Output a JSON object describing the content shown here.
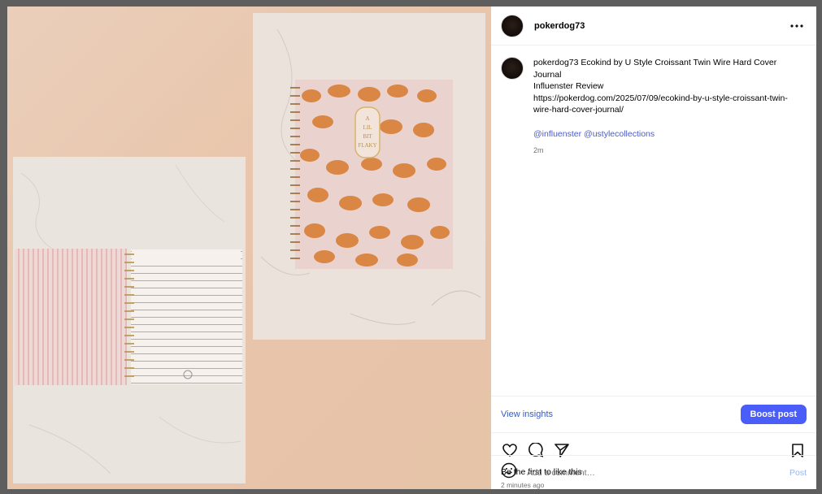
{
  "post": {
    "username": "pokerdog73",
    "caption_user": "pokerdog73",
    "caption_lines": [
      "Ecokind by U Style Croissant Twin Wire Hard Cover Journal",
      "Influenster Review",
      "https://pokerdog.com/2025/07/09/ecokind-by-u-style-croissant-twin-wire-hard-cover-journal/"
    ],
    "mentions": [
      "@influenster",
      "@ustylecollections"
    ],
    "caption_age": "2m",
    "likes_text": "Be the first to like this",
    "posted_ago": "2 minutes ago",
    "more_icon": "more-horizontal-icon"
  },
  "insights": {
    "view_label": "View insights",
    "boost_label": "Boost post"
  },
  "comment": {
    "placeholder": "Add a comment…",
    "post_label": "Post"
  },
  "journal_cover_text": [
    "A",
    "LIL",
    "BIT",
    "FLAKY"
  ],
  "colors": {
    "accent": "#4a5df9",
    "link": "#3b5bb5",
    "muted": "#737373",
    "post_disabled": "#9ab5ee",
    "media_bg": "#e9c8ad"
  }
}
